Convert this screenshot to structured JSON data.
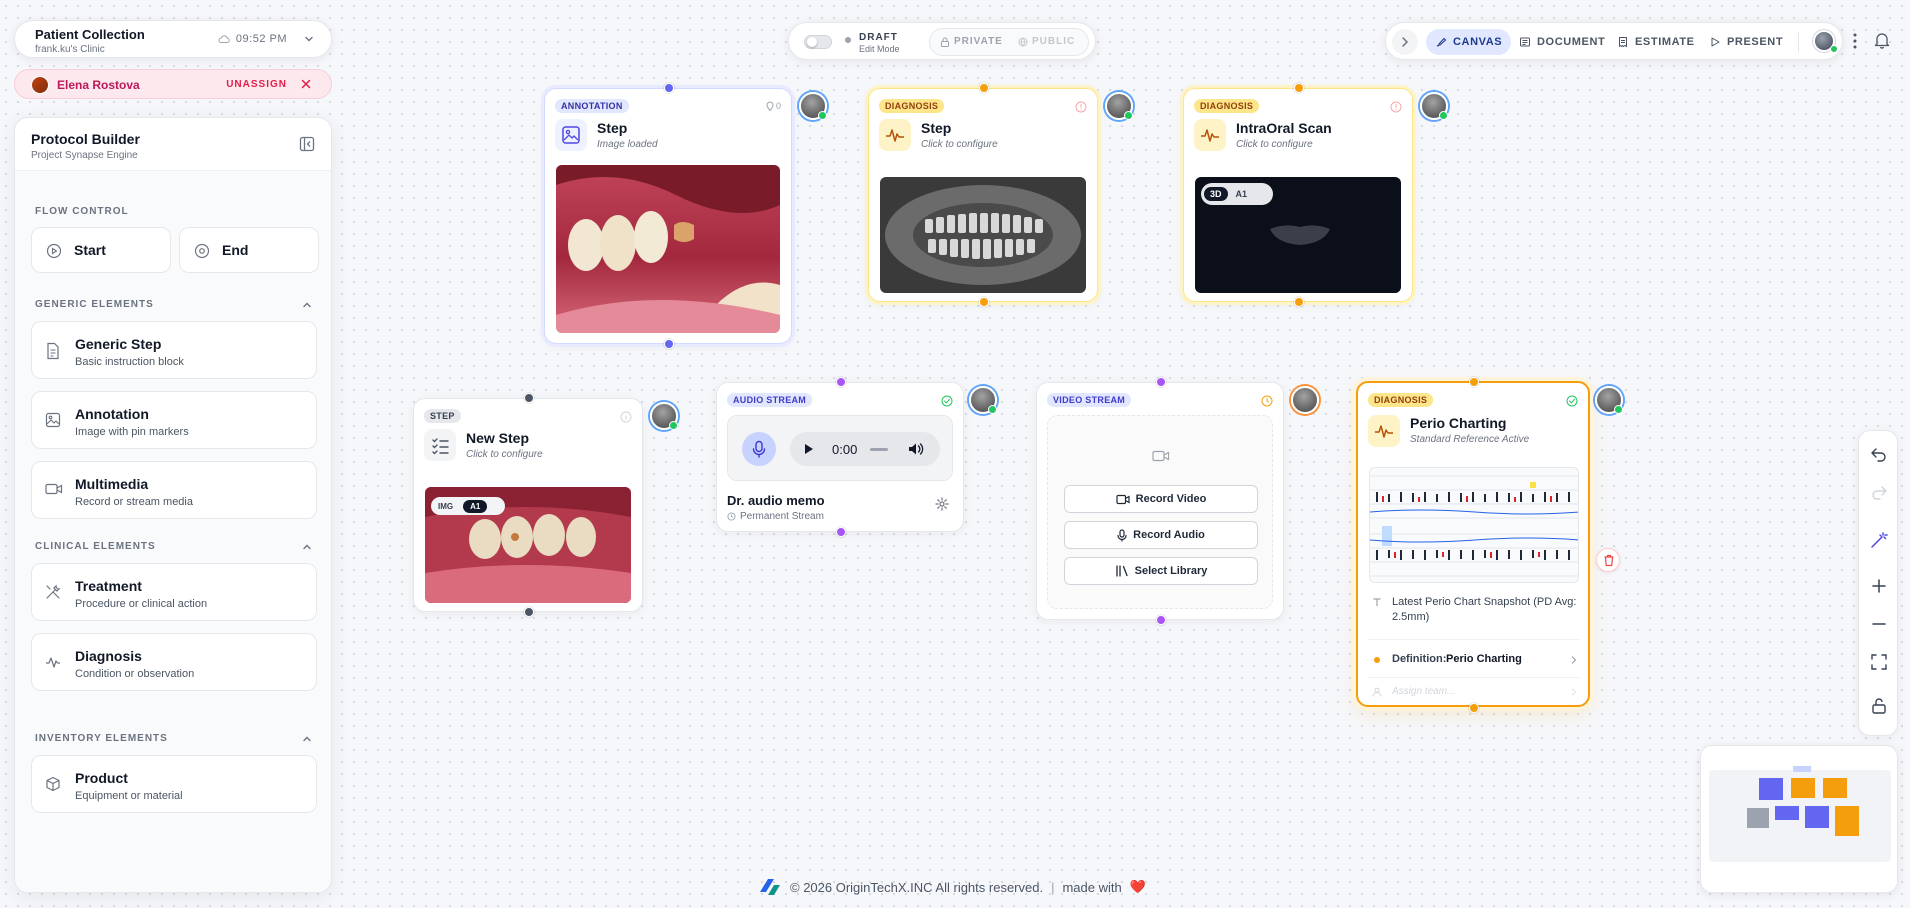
{
  "patient": {
    "title": "Patient Collection",
    "clinic": "frank.ku's Clinic",
    "time": "09:52 PM"
  },
  "assignee": {
    "name": "Elena Rostova",
    "unassign_label": "UNASSIGN"
  },
  "sidebar": {
    "title": "Protocol Builder",
    "subtitle": "Project Synapse Engine",
    "flow_control": {
      "label": "FLOW CONTROL",
      "start": "Start",
      "end": "End"
    },
    "generic": {
      "label": "GENERIC ELEMENTS",
      "items": [
        {
          "title": "Generic Step",
          "desc": "Basic instruction block"
        },
        {
          "title": "Annotation",
          "desc": "Image with pin markers"
        },
        {
          "title": "Multimedia",
          "desc": "Record or stream media"
        }
      ]
    },
    "clinical": {
      "label": "CLINICAL ELEMENTS",
      "items": [
        {
          "title": "Treatment",
          "desc": "Procedure or clinical action"
        },
        {
          "title": "Diagnosis",
          "desc": "Condition or observation"
        }
      ]
    },
    "inventory": {
      "label": "INVENTORY ELEMENTS",
      "items": [
        {
          "title": "Product",
          "desc": "Equipment or material"
        }
      ]
    }
  },
  "mode": {
    "label": "DRAFT",
    "sub": "Edit Mode",
    "private": "PRIVATE",
    "public": "PUBLIC"
  },
  "nav": {
    "tabs": [
      "CANVAS",
      "DOCUMENT",
      "ESTIMATE",
      "PRESENT"
    ],
    "active": "CANVAS"
  },
  "nodes": {
    "annotation": {
      "badge": "ANNOTATION",
      "count": "0",
      "title": "Step",
      "sub": "Image loaded"
    },
    "diagnosis1": {
      "badge": "DIAGNOSIS",
      "title": "Step",
      "sub": "Click to configure"
    },
    "diagnosis2": {
      "badge": "DIAGNOSIS",
      "title": "IntraOral Scan",
      "sub": "Click to configure",
      "chip_3d": "3D",
      "chip_a1": "A1"
    },
    "step": {
      "badge": "STEP",
      "title": "New Step",
      "sub": "Click to configure",
      "chip_img": "IMG",
      "chip_a1": "A1"
    },
    "audio": {
      "badge": "AUDIO STREAM",
      "time": "0:00",
      "title": "Dr. audio memo",
      "sub": "Permanent Stream"
    },
    "video": {
      "badge": "VIDEO STREAM",
      "record_video": "Record Video",
      "record_audio": "Record Audio",
      "select_library": "Select Library"
    },
    "perio": {
      "badge": "DIAGNOSIS",
      "title": "Perio Charting",
      "sub": "Standard Reference Active",
      "snapshot": "Latest Perio Chart Snapshot (PD Avg: 2.5mm)",
      "definition_label": "Definition:",
      "definition_value": "Perio Charting",
      "assign_placeholder": "Assign team..."
    }
  },
  "footer": {
    "copyright": "© 2026 OriginTechX.INC All rights reserved.",
    "separator": "|",
    "made_with": "made with",
    "heart": "❤️"
  },
  "icons": {
    "clock": "cloud-clock-icon",
    "chevron": "chevron-down-icon",
    "close": "close-icon",
    "collapse": "sidebar-collapse-icon"
  },
  "colors": {
    "accent_blue": "#6366f1",
    "accent_orange": "#f59e0b",
    "accent_purple": "#a855f7",
    "assign_pink": "#be185d"
  }
}
